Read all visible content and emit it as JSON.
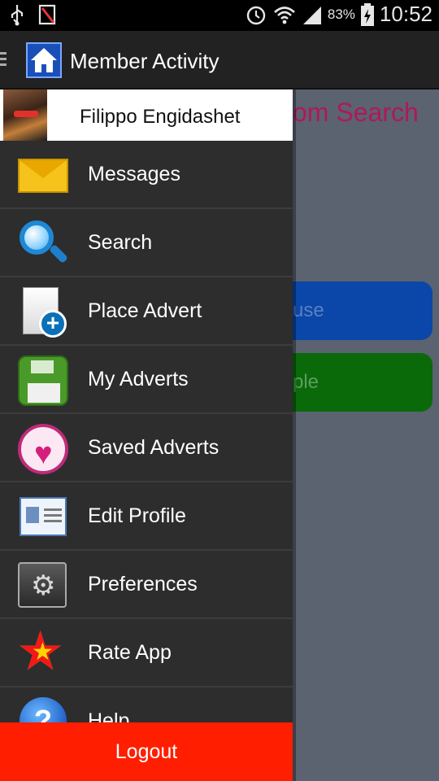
{
  "status_bar": {
    "battery_percent": "83%",
    "time": "10:52",
    "icons": [
      "usb-icon",
      "no-sim-icon",
      "alarm-icon",
      "wifi-icon",
      "signal-icon",
      "battery-icon"
    ]
  },
  "action_bar": {
    "title": "Member Activity",
    "icon": "home-icon"
  },
  "background_content": {
    "heading_fragment": "om Search",
    "button_blue_fragment": "use",
    "button_green_fragment": "ple",
    "colors": {
      "heading": "#b0185c",
      "blue": "#0b47a8",
      "green": "#0a6a0a"
    }
  },
  "drawer": {
    "profile_name": "Filippo Engidashet",
    "items": [
      {
        "label": "Messages",
        "icon": "envelope-icon"
      },
      {
        "label": "Search",
        "icon": "magnifier-icon"
      },
      {
        "label": "Place Advert",
        "icon": "add-document-icon"
      },
      {
        "label": "My Adverts",
        "icon": "floppy-disk-icon"
      },
      {
        "label": "Saved Adverts",
        "icon": "heart-icon"
      },
      {
        "label": "Edit Profile",
        "icon": "profile-card-icon"
      },
      {
        "label": "Preferences",
        "icon": "gear-icon"
      },
      {
        "label": "Rate App",
        "icon": "star-icon"
      },
      {
        "label": "Help",
        "icon": "help-icon"
      }
    ],
    "logout_label": "Logout",
    "colors": {
      "background": "#2d2d2d",
      "logout": "#ff1e00"
    }
  }
}
